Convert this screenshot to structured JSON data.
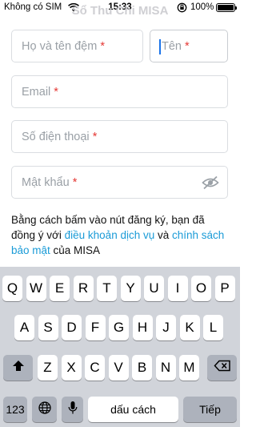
{
  "status_bar": {
    "carrier": "Không có SIM",
    "time": "15:33",
    "battery": "100%",
    "icons": [
      "wifi-icon",
      "orientation-lock-icon",
      "battery-icon"
    ]
  },
  "app": {
    "title": "Sổ Thu Chi MISA"
  },
  "form": {
    "full_name_placeholder": "Họ và tên đệm",
    "first_name_placeholder": "Tên",
    "email_placeholder": "Email",
    "phone_placeholder": "Số điện thoại",
    "password_placeholder": "Mật khẩu",
    "required_mark": "*"
  },
  "terms": {
    "prefix": "Bằng cách bấm vào nút đăng ký, bạn đã đồng ý với ",
    "link_terms": "điều khoản dịch vụ",
    "and": " và ",
    "link_privacy": "chính sách bảo mật",
    "suffix": " của MISA"
  },
  "keyboard": {
    "row1": [
      "Q",
      "W",
      "E",
      "R",
      "T",
      "Y",
      "U",
      "I",
      "O",
      "P"
    ],
    "row2": [
      "A",
      "S",
      "D",
      "F",
      "G",
      "H",
      "J",
      "K",
      "L"
    ],
    "row3": [
      "Z",
      "X",
      "C",
      "V",
      "B",
      "N",
      "M"
    ],
    "numbers_key": "123",
    "space_key": "dấu cách",
    "return_key": "Tiếp",
    "icons": [
      "shift-icon",
      "backspace-icon",
      "globe-icon",
      "microphone-icon"
    ]
  },
  "colors": {
    "link": "#1a9bd7",
    "required": "#e53935",
    "cursor": "#1a73e8",
    "keyboard_bg": "#d1d4da"
  }
}
